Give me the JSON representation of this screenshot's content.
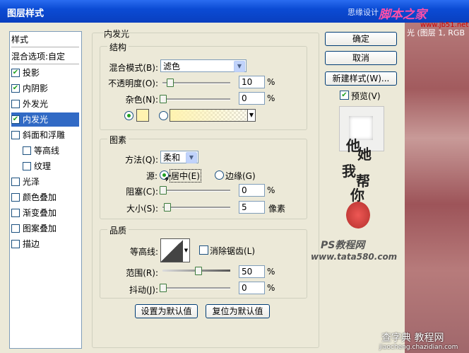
{
  "window": {
    "title": "图层样式",
    "subtitle": "思缘设计",
    "watermark_top": "脚本之家",
    "watermark_url": "www.jb51.net",
    "photo_caption": "光 (图层 1, RGB"
  },
  "style_list": {
    "header": "样式",
    "blend_options": "混合选项:自定",
    "items": [
      {
        "label": "投影",
        "checked": true
      },
      {
        "label": "内阴影",
        "checked": true
      },
      {
        "label": "外发光",
        "checked": false
      },
      {
        "label": "内发光",
        "checked": true,
        "selected": true
      },
      {
        "label": "斜面和浮雕",
        "checked": false
      },
      {
        "label": "等高线",
        "checked": false,
        "indent": true
      },
      {
        "label": "纹理",
        "checked": false,
        "indent": true
      },
      {
        "label": "光泽",
        "checked": false
      },
      {
        "label": "颜色叠加",
        "checked": false
      },
      {
        "label": "渐变叠加",
        "checked": false
      },
      {
        "label": "图案叠加",
        "checked": false
      },
      {
        "label": "描边",
        "checked": false
      }
    ]
  },
  "panel": {
    "title": "内发光",
    "structure": {
      "legend": "结构",
      "blend_mode_label": "混合模式(B):",
      "blend_mode_value": "滤色",
      "opacity_label": "不透明度(O):",
      "opacity_value": "10",
      "opacity_unit": "%",
      "noise_label": "杂色(N):",
      "noise_value": "0",
      "noise_unit": "%"
    },
    "elements": {
      "legend": "图素",
      "method_label": "方法(Q):",
      "method_value": "柔和",
      "source_label": "源:",
      "source_center": "居中(E)",
      "source_edge": "边缘(G)",
      "choke_label": "阻塞(C):",
      "choke_value": "0",
      "choke_unit": "%",
      "size_label": "大小(S):",
      "size_value": "5",
      "size_unit": "像素"
    },
    "quality": {
      "legend": "品质",
      "contour_label": "等高线:",
      "antialias_label": "消除锯齿(L)",
      "range_label": "范围(R):",
      "range_value": "50",
      "range_unit": "%",
      "jitter_label": "抖动(J):",
      "jitter_value": "0",
      "jitter_unit": "%"
    },
    "make_default": "设置为默认值",
    "reset_default": "复位为默认值"
  },
  "buttons": {
    "ok": "确定",
    "cancel": "取消",
    "new_style": "新建样式(W)...",
    "preview": "预览(V)"
  },
  "overlay": {
    "calligraphy": [
      "他",
      "她",
      "我",
      "帮",
      "你"
    ],
    "ps_site": "PS教程网",
    "ps_url": "www.tata580.com",
    "bottom_watermark": "查字典 教程网",
    "bottom_url": "jiaocheng.chazidian.com"
  },
  "colors": {
    "glow_color": "#fff3b0",
    "selected_bg": "#316ac5"
  }
}
